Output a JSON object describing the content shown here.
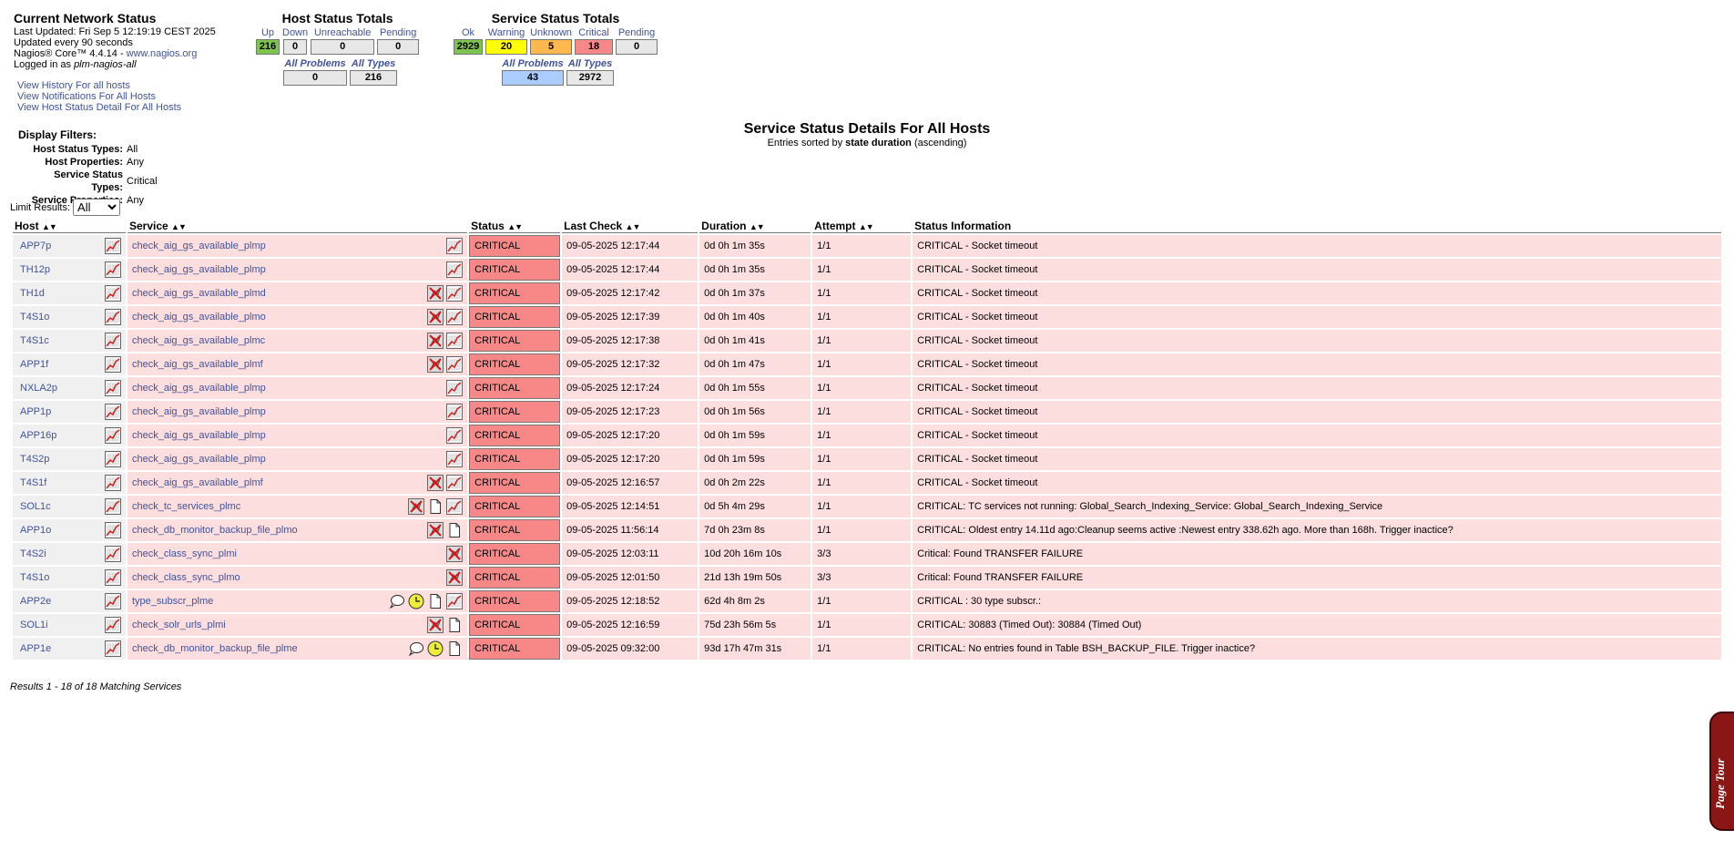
{
  "info": {
    "title": "Current Network Status",
    "last_updated": "Last Updated: Fri Sep 5 12:19:19 CEST 2025",
    "update_interval": "Updated every 90 seconds",
    "version_prefix": "Nagios® Core™ 4.4.14 - ",
    "website": "www.nagios.org",
    "logged_in_prefix": "Logged in as ",
    "user": "plm-nagios-all"
  },
  "quick_links": [
    "View History For all hosts",
    "View Notifications For All Hosts",
    "View Host Status Detail For All Hosts"
  ],
  "host_totals": {
    "title": "Host Status Totals",
    "cells": [
      {
        "label": "Up",
        "value": "216",
        "color": "#7dc44e"
      },
      {
        "label": "Down",
        "value": "0",
        "color": "#e7e7e7"
      },
      {
        "label": "Unreachable",
        "value": "0",
        "color": "#e7e7e7"
      },
      {
        "label": "Pending",
        "value": "0",
        "color": "#e7e7e7"
      }
    ],
    "sub": [
      {
        "label": "All Problems",
        "value": "0",
        "color": "#e7e7e7"
      },
      {
        "label": "All Types",
        "value": "216",
        "color": "#e7e7e7"
      }
    ]
  },
  "service_totals": {
    "title": "Service Status Totals",
    "cells": [
      {
        "label": "Ok",
        "value": "2929",
        "color": "#7dc44e"
      },
      {
        "label": "Warning",
        "value": "20",
        "color": "#ffff00"
      },
      {
        "label": "Unknown",
        "value": "5",
        "color": "#ffb84d"
      },
      {
        "label": "Critical",
        "value": "18",
        "color": "#f88888"
      },
      {
        "label": "Pending",
        "value": "0",
        "color": "#e7e7e7"
      }
    ],
    "sub": [
      {
        "label": "All Problems",
        "value": "43",
        "color": "#aaccff"
      },
      {
        "label": "All Types",
        "value": "2972",
        "color": "#e7e7e7"
      }
    ]
  },
  "filters": {
    "title": "Display Filters:",
    "rows": [
      {
        "key": "Host Status Types:",
        "value": "All"
      },
      {
        "key": "Host Properties:",
        "value": "Any"
      },
      {
        "key": "Service Status Types:",
        "value": "Critical"
      },
      {
        "key": "Service Properties:",
        "value": "Any"
      }
    ]
  },
  "heading": {
    "title": "Service Status Details For All Hosts",
    "sub_prefix": "Entries sorted by ",
    "sub_key": "state duration",
    "sub_suffix": " (ascending)"
  },
  "limit": {
    "label": "Limit Results:",
    "value": "All"
  },
  "columns": [
    "Host",
    "Service",
    "Status",
    "Last Check",
    "Duration",
    "Attempt",
    "Status Information"
  ],
  "rows": [
    {
      "host": "APP7p",
      "service": "check_aig_gs_available_plmp",
      "icons": [
        "graph"
      ],
      "status": "CRITICAL",
      "last_check": "09-05-2025 12:17:44",
      "duration": "0d 0h 1m 35s",
      "attempt": "1/1",
      "info": "CRITICAL - Socket timeout"
    },
    {
      "host": "TH12p",
      "service": "check_aig_gs_available_plmp",
      "icons": [
        "graph"
      ],
      "status": "CRITICAL",
      "last_check": "09-05-2025 12:17:44",
      "duration": "0d 0h 1m 35s",
      "attempt": "1/1",
      "info": "CRITICAL - Socket timeout"
    },
    {
      "host": "TH1d",
      "service": "check_aig_gs_available_plmd",
      "icons": [
        "notif-off",
        "graph"
      ],
      "status": "CRITICAL",
      "last_check": "09-05-2025 12:17:42",
      "duration": "0d 0h 1m 37s",
      "attempt": "1/1",
      "info": "CRITICAL - Socket timeout"
    },
    {
      "host": "T4S1o",
      "service": "check_aig_gs_available_plmo",
      "icons": [
        "notif-off",
        "graph"
      ],
      "status": "CRITICAL",
      "last_check": "09-05-2025 12:17:39",
      "duration": "0d 0h 1m 40s",
      "attempt": "1/1",
      "info": "CRITICAL - Socket timeout"
    },
    {
      "host": "T4S1c",
      "service": "check_aig_gs_available_plmc",
      "icons": [
        "notif-off",
        "graph"
      ],
      "status": "CRITICAL",
      "last_check": "09-05-2025 12:17:38",
      "duration": "0d 0h 1m 41s",
      "attempt": "1/1",
      "info": "CRITICAL - Socket timeout"
    },
    {
      "host": "APP1f",
      "service": "check_aig_gs_available_plmf",
      "icons": [
        "notif-off",
        "graph"
      ],
      "status": "CRITICAL",
      "last_check": "09-05-2025 12:17:32",
      "duration": "0d 0h 1m 47s",
      "attempt": "1/1",
      "info": "CRITICAL - Socket timeout"
    },
    {
      "host": "NXLA2p",
      "service": "check_aig_gs_available_plmp",
      "icons": [
        "graph"
      ],
      "status": "CRITICAL",
      "last_check": "09-05-2025 12:17:24",
      "duration": "0d 0h 1m 55s",
      "attempt": "1/1",
      "info": "CRITICAL - Socket timeout"
    },
    {
      "host": "APP1p",
      "service": "check_aig_gs_available_plmp",
      "icons": [
        "graph"
      ],
      "status": "CRITICAL",
      "last_check": "09-05-2025 12:17:23",
      "duration": "0d 0h 1m 56s",
      "attempt": "1/1",
      "info": "CRITICAL - Socket timeout"
    },
    {
      "host": "APP16p",
      "service": "check_aig_gs_available_plmp",
      "icons": [
        "graph"
      ],
      "status": "CRITICAL",
      "last_check": "09-05-2025 12:17:20",
      "duration": "0d 0h 1m 59s",
      "attempt": "1/1",
      "info": "CRITICAL - Socket timeout"
    },
    {
      "host": "T4S2p",
      "service": "check_aig_gs_available_plmp",
      "icons": [
        "graph"
      ],
      "status": "CRITICAL",
      "last_check": "09-05-2025 12:17:20",
      "duration": "0d 0h 1m 59s",
      "attempt": "1/1",
      "info": "CRITICAL - Socket timeout"
    },
    {
      "host": "T4S1f",
      "service": "check_aig_gs_available_plmf",
      "icons": [
        "notif-off",
        "graph"
      ],
      "status": "CRITICAL",
      "last_check": "09-05-2025 12:16:57",
      "duration": "0d 0h 2m 22s",
      "attempt": "1/1",
      "info": "CRITICAL - Socket timeout"
    },
    {
      "host": "SOL1c",
      "service": "check_tc_services_plmc",
      "icons": [
        "notif-off",
        "notes",
        "graph"
      ],
      "status": "CRITICAL",
      "last_check": "09-05-2025 12:14:51",
      "duration": "0d 5h 4m 29s",
      "attempt": "1/1",
      "info": "CRITICAL: TC services not running: Global_Search_Indexing_Service: Global_Search_Indexing_Service"
    },
    {
      "host": "APP1o",
      "service": "check_db_monitor_backup_file_plmo",
      "icons": [
        "notif-off",
        "notes"
      ],
      "status": "CRITICAL",
      "last_check": "09-05-2025 11:56:14",
      "duration": "7d 0h 23m 8s",
      "attempt": "1/1",
      "info": "CRITICAL: Oldest entry 14.11d ago:Cleanup seems active :Newest entry 338.62h ago. More than 168h. Trigger inactice?"
    },
    {
      "host": "T4S2i",
      "service": "check_class_sync_plmi",
      "icons": [
        "notif-off"
      ],
      "status": "CRITICAL",
      "last_check": "09-05-2025 12:03:11",
      "duration": "10d 20h 16m 10s",
      "attempt": "3/3",
      "info": "Critical: Found TRANSFER FAILURE"
    },
    {
      "host": "T4S1o",
      "service": "check_class_sync_plmo",
      "icons": [
        "notif-off"
      ],
      "status": "CRITICAL",
      "last_check": "09-05-2025 12:01:50",
      "duration": "21d 13h 19m 50s",
      "attempt": "3/3",
      "info": "Critical: Found TRANSFER FAILURE"
    },
    {
      "host": "APP2e",
      "service": "type_subscr_plme",
      "icons": [
        "comment",
        "downtime",
        "notes",
        "graph"
      ],
      "status": "CRITICAL",
      "last_check": "09-05-2025 12:18:52",
      "duration": "62d 4h 8m 2s",
      "attempt": "1/1",
      "info": "CRITICAL : 30 type subscr.:"
    },
    {
      "host": "SOL1i",
      "service": "check_solr_urls_plmi",
      "icons": [
        "notif-off",
        "notes"
      ],
      "status": "CRITICAL",
      "last_check": "09-05-2025 12:16:59",
      "duration": "75d 23h 56m 5s",
      "attempt": "1/1",
      "info": "CRITICAL: 30883 (Timed Out): 30884 (Timed Out)"
    },
    {
      "host": "APP1e",
      "service": "check_db_monitor_backup_file_plme",
      "icons": [
        "comment",
        "downtime",
        "notes"
      ],
      "status": "CRITICAL",
      "last_check": "09-05-2025 09:32:00",
      "duration": "93d 17h 47m 31s",
      "attempt": "1/1",
      "info": "CRITICAL: No entries found in Table BSH_BACKUP_FILE. Trigger inactice?"
    }
  ],
  "results": "Results 1 - 18 of 18 Matching Services",
  "page_tour": "Page Tour"
}
